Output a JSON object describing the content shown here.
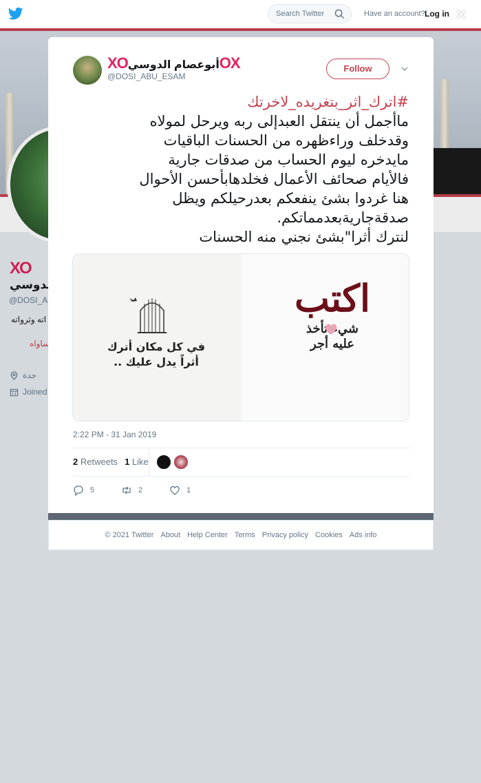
{
  "header": {
    "search_placeholder": "Search Twitter",
    "have_account": "Have an account?",
    "login": "Log in"
  },
  "profile": {
    "name": "الدوسي",
    "handle": "@DOSI_A",
    "bio_fragment": "اته وثرواته",
    "link_fragment": "ساواه",
    "location": "جدة",
    "joined": "Joined"
  },
  "tweet": {
    "author_name": "أبوعصام الدوسي",
    "author_handle": "@DOSI_ABU_ESAM",
    "follow_label": "Follow",
    "hashtag": "#اترك_اثر_بتغريده_لاخرتك",
    "lines": [
      "ماأجمل أن ينتقل العبدإلى ربه ويرحل لمولاه",
      "وقدخلف وراءظهره من الحسنات الباقيات",
      "مايدخره ليوم الحساب من صدقات جارية",
      "فالأيام صحائف الأعمال فخلدهابأحسن الأحوال",
      "هنا غردوا بشئ ينفعكم بعدرحيلكم ويظل",
      "صدقةجاريةبعدمماتكم.",
      "لنترك أثرا\"بشئ نجني منه الحسنات"
    ],
    "image_left_text": [
      "في كل مكان أترك",
      "أثراً يدل عليك .."
    ],
    "image_right_text": [
      "اكتب",
      "شيء تأخذ",
      "عليه أجر"
    ],
    "timestamp": "2:22 PM - 31 Jan 2019",
    "retweets_count": "2",
    "retweets_label": "Retweets",
    "likes_count": "1",
    "likes_label": "Like",
    "reply_count": "5",
    "retweet_count": "2",
    "like_count": "1"
  },
  "footer": {
    "links": [
      "© 2021 Twitter",
      "About",
      "Help Center",
      "Terms",
      "Privacy policy",
      "Cookies",
      "Ads info"
    ]
  },
  "colors": {
    "accent": "#c4434f",
    "logo_pink": "#e0245e",
    "twitter_blue": "#1da1f2"
  }
}
